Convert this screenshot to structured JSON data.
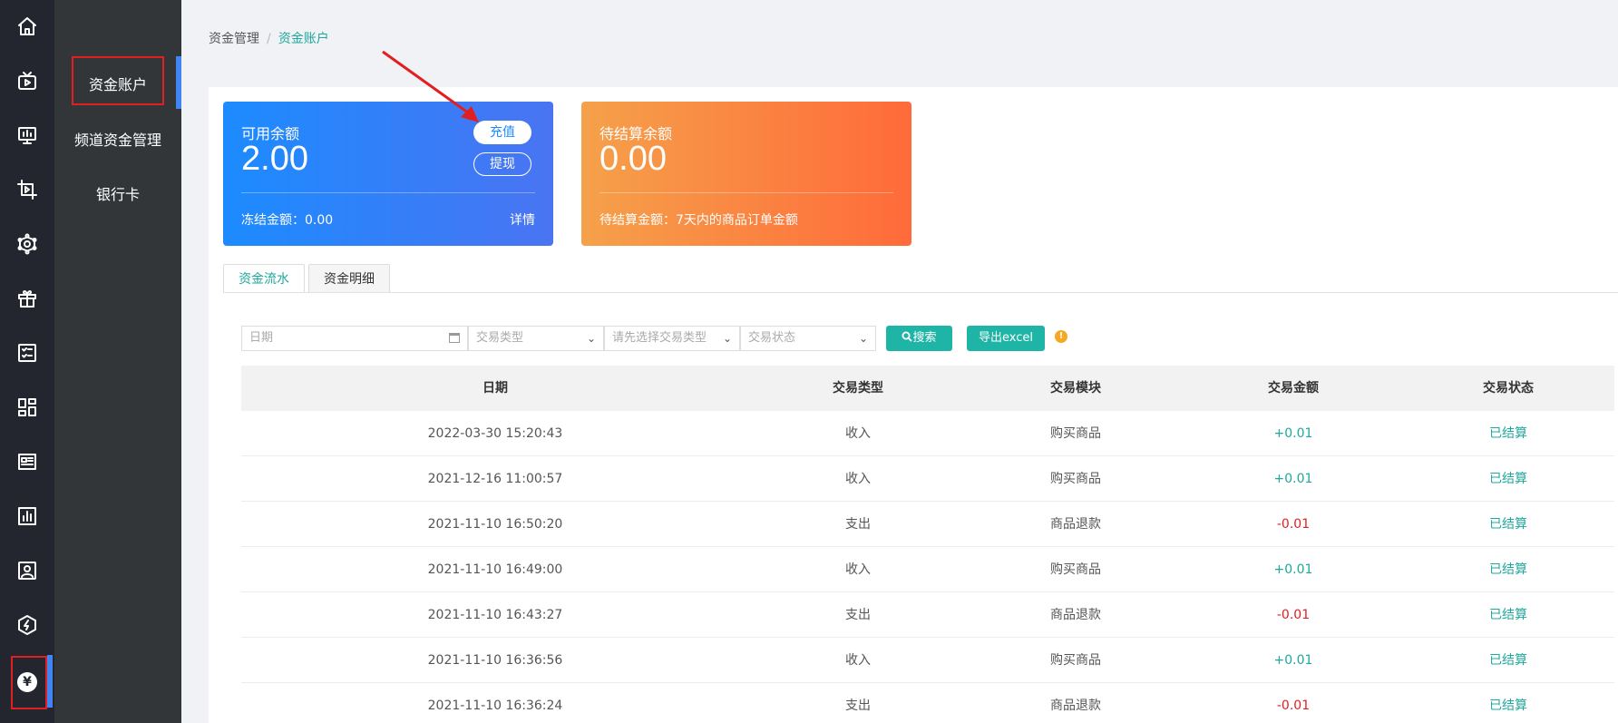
{
  "rail": {
    "icons": [
      "home-icon",
      "tv-icon",
      "monitor-chart-icon",
      "crop-video-icon",
      "network-icon",
      "gift-icon",
      "checklist-icon",
      "dashboard-icon",
      "news-icon",
      "bar-chart-icon",
      "user-card-icon",
      "hexagon-bolt-icon",
      "yen-icon"
    ],
    "yen_symbol": "¥"
  },
  "submenu": {
    "items": [
      "资金账户",
      "频道资金管理",
      "银行卡"
    ]
  },
  "breadcrumb": {
    "parent": "资金管理",
    "separator": "/",
    "current": "资金账户"
  },
  "cards": {
    "available": {
      "label": "可用余额",
      "amount": "2.00",
      "recharge": "充值",
      "withdraw": "提现",
      "frozen": "冻结金额：0.00",
      "detail": "详情"
    },
    "pending": {
      "label": "待结算余额",
      "amount": "0.00",
      "note": "待结算金额：7天内的商品订单金额"
    }
  },
  "tabs": [
    "资金流水",
    "资金明细"
  ],
  "filters": {
    "date_placeholder": "日期",
    "type_placeholder": "交易类型",
    "subtype_placeholder": "请先选择交易类型",
    "status_placeholder": "交易状态",
    "search_label": "搜索",
    "export_label": "导出excel",
    "warn_symbol": "!"
  },
  "table": {
    "headers": [
      "日期",
      "交易类型",
      "交易模块",
      "交易金额",
      "交易状态"
    ],
    "rows": [
      [
        "2022-03-30 15:20:43",
        "收入",
        "购买商品",
        "+0.01",
        "已结算"
      ],
      [
        "2021-12-16 11:00:57",
        "收入",
        "购买商品",
        "+0.01",
        "已结算"
      ],
      [
        "2021-11-10 16:50:20",
        "支出",
        "商品退款",
        "-0.01",
        "已结算"
      ],
      [
        "2021-11-10 16:49:00",
        "收入",
        "购买商品",
        "+0.01",
        "已结算"
      ],
      [
        "2021-11-10 16:43:27",
        "支出",
        "商品退款",
        "-0.01",
        "已结算"
      ],
      [
        "2021-11-10 16:36:56",
        "收入",
        "购买商品",
        "+0.01",
        "已结算"
      ],
      [
        "2021-11-10 16:36:24",
        "支出",
        "商品退款",
        "-0.01",
        "已结算"
      ]
    ]
  },
  "colors": {
    "accent": "#1fa89c",
    "positive": "#1fa89c",
    "negative": "#e02020",
    "annotation": "#e02020"
  }
}
